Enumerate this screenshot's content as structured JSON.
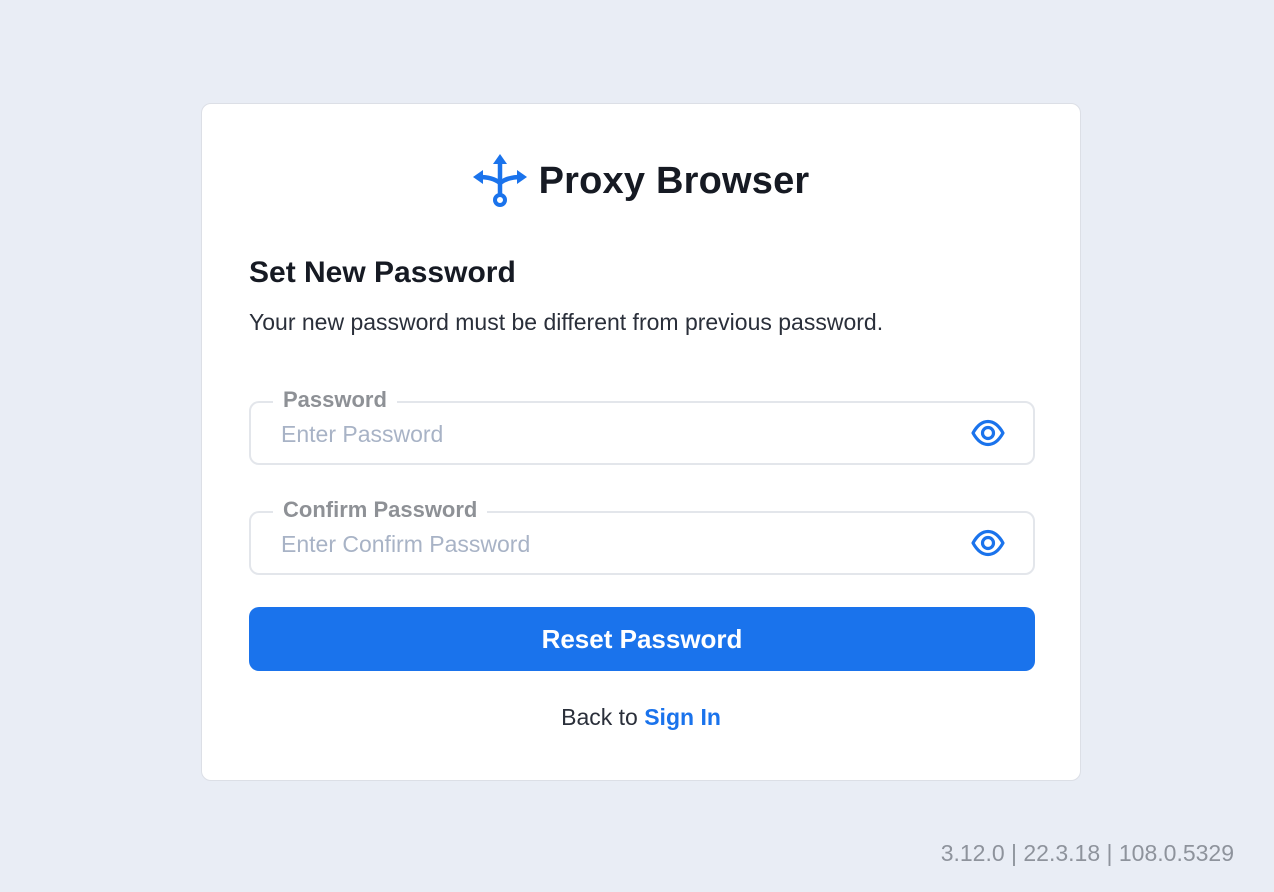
{
  "brand": {
    "name": "Proxy Browser",
    "logo_icon": "split-arrows-icon",
    "accent_color": "#1a73ec"
  },
  "form": {
    "title": "Set New Password",
    "subtitle": "Your new password must be different from previous password.",
    "password": {
      "label": "Password",
      "placeholder": "Enter Password",
      "value": "",
      "toggle_icon": "eye-icon"
    },
    "confirm_password": {
      "label": "Confirm Password",
      "placeholder": "Enter Confirm Password",
      "value": "",
      "toggle_icon": "eye-icon"
    },
    "submit_label": "Reset Password"
  },
  "footer": {
    "back_text": "Back to",
    "sign_in_link": "Sign In"
  },
  "version": "3.12.0 | 22.3.18 | 108.0.5329"
}
